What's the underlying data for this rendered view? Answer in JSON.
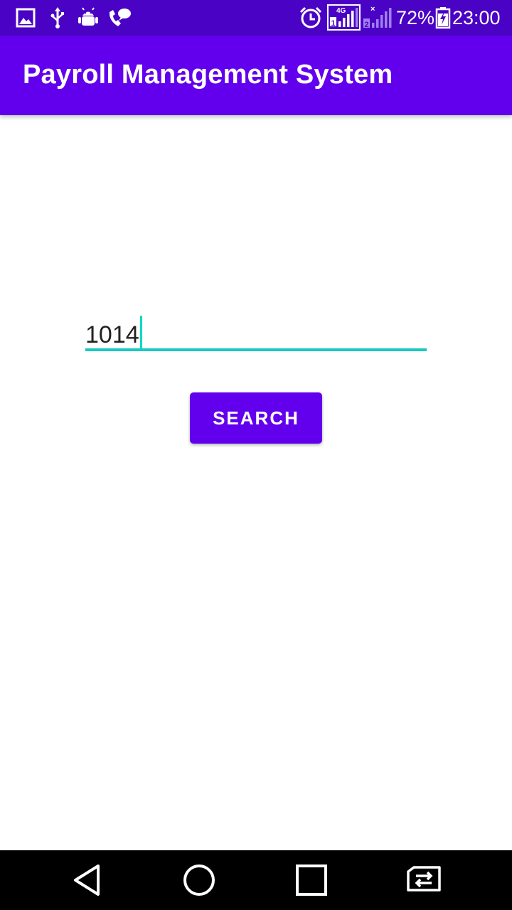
{
  "status_bar": {
    "battery_percent": "72%",
    "time": "23:00",
    "network_label": "4G",
    "sim1_label": "1",
    "sim2_label": "2",
    "icons": [
      "gallery-icon",
      "usb-icon",
      "android-debug-icon",
      "voicemail-icon",
      "alarm-icon",
      "signal-sim1-icon",
      "signal-sim2-icon",
      "battery-charging-icon"
    ]
  },
  "app_bar": {
    "title": "Payroll Management System"
  },
  "search": {
    "value": "1014",
    "button_label": "SEARCH"
  },
  "nav_bar": {
    "icons": [
      "back-icon",
      "home-icon",
      "recents-icon",
      "sim-switch-icon"
    ]
  },
  "colors": {
    "status_bar": "#4a02c4",
    "primary": "#6200ee",
    "accent": "#03dac5",
    "underline": "#1ac9c0",
    "nav_bar": "#000000"
  }
}
